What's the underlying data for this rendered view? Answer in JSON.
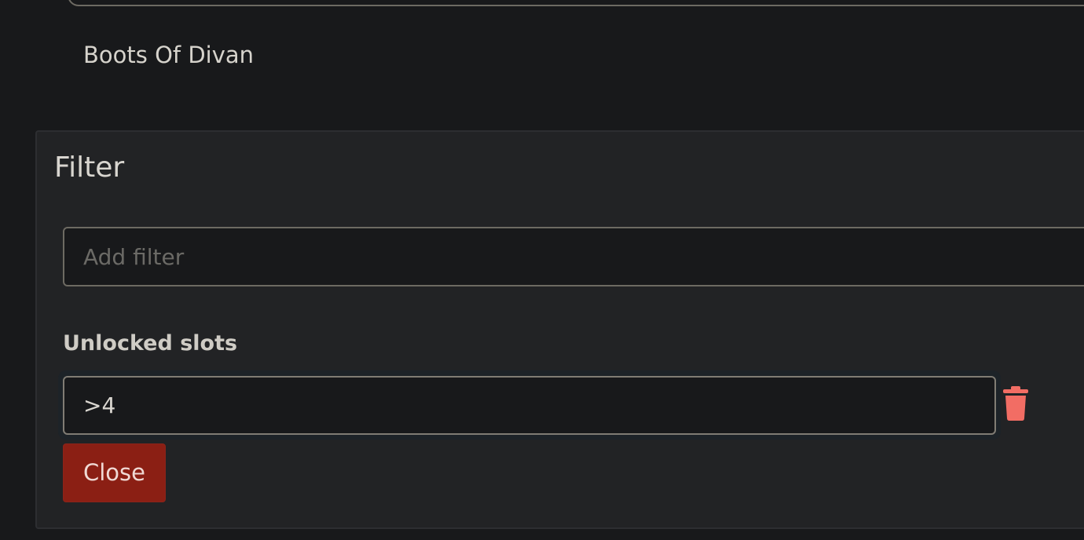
{
  "results": {
    "item_name": "Boots Of Divan"
  },
  "filter_panel": {
    "title": "Filter",
    "add_filter_placeholder": "Add filter",
    "filters": [
      {
        "label": "Unlocked slots",
        "value": ">4",
        "remove_icon": "trash-icon"
      }
    ],
    "close_label": "Close"
  },
  "colors": {
    "background": "#18191b",
    "panel": "#222325",
    "close_button": "#8b1f14",
    "trash_icon": "#f26d64"
  }
}
